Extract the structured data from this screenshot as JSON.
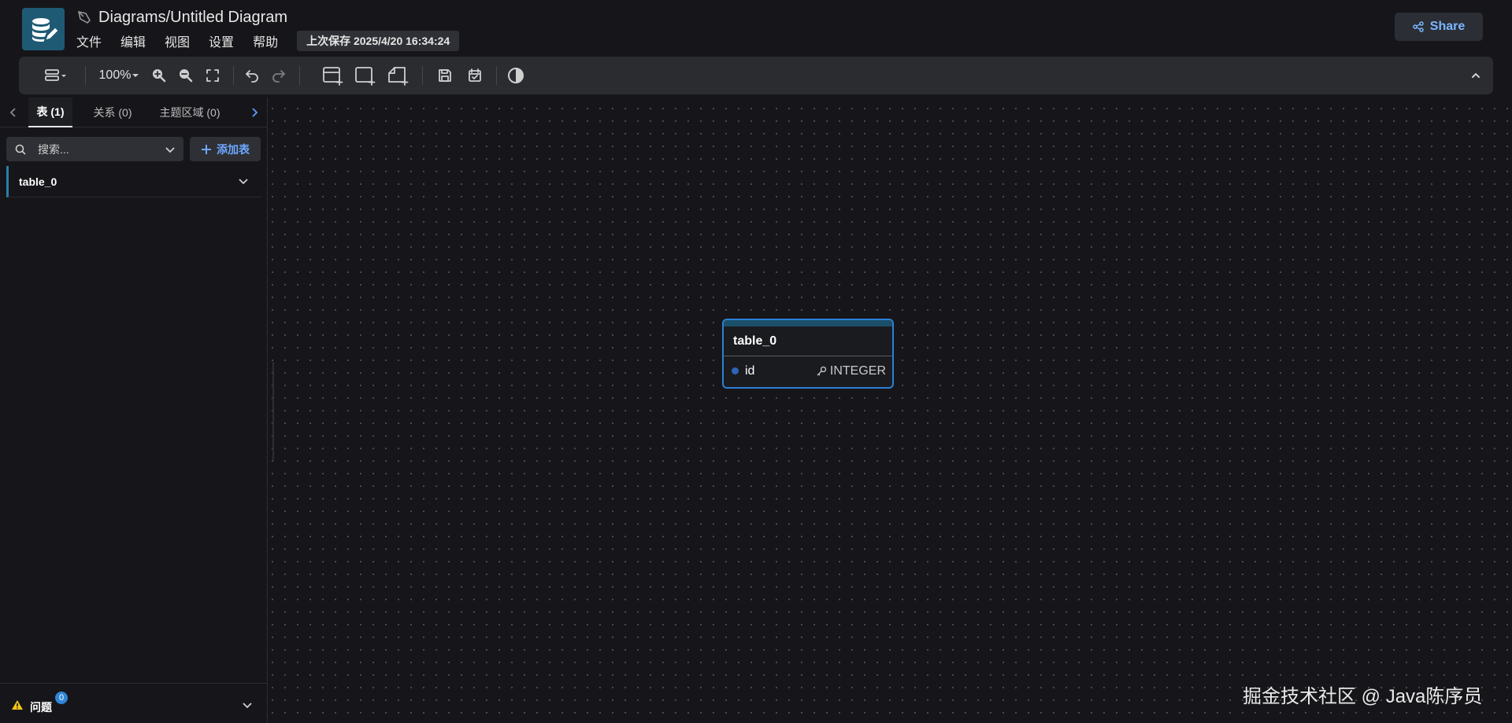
{
  "header": {
    "title": "Diagrams/Untitled Diagram",
    "menu": [
      "文件",
      "编辑",
      "视图",
      "设置",
      "帮助"
    ],
    "last_saved": "上次保存 2025/4/20 16:34:24",
    "share_label": "Share"
  },
  "toolbar": {
    "zoom": "100%"
  },
  "sidebar": {
    "tabs": [
      {
        "label": "表 (1)"
      },
      {
        "label": "关系 (0)"
      },
      {
        "label": "主题区域 (0)"
      }
    ],
    "search_placeholder": "搜索...",
    "add_table_label": "添加表",
    "tables": [
      {
        "name": "table_0"
      }
    ],
    "issues": {
      "label": "问题",
      "count": "0"
    }
  },
  "diagram": {
    "tables": [
      {
        "name": "table_0",
        "header_color": "#1b4f6a",
        "fields": [
          {
            "name": "id",
            "type": "INTEGER",
            "primary_key": true
          }
        ]
      }
    ]
  },
  "watermark": "掘金技术社区 @ Java陈序员",
  "colors": {
    "accent": "#2d7fd6",
    "share_text": "#7bb6ff",
    "add_table_text": "#6ea8ff",
    "warning": "#f5c518"
  }
}
